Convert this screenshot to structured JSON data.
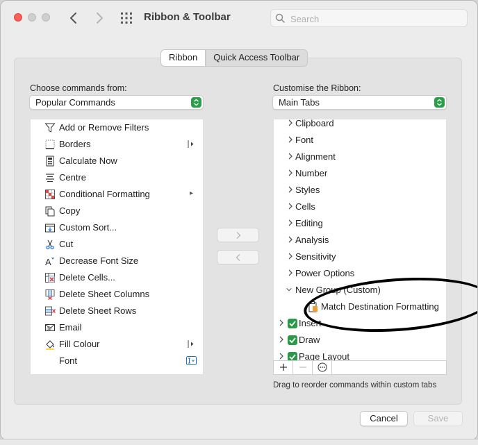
{
  "window": {
    "title": "Ribbon & Toolbar"
  },
  "search": {
    "placeholder": "Search"
  },
  "tabs": [
    {
      "label": "Ribbon",
      "active": true
    },
    {
      "label": "Quick Access Toolbar",
      "active": false
    }
  ],
  "left": {
    "label": "Choose commands from:",
    "selected": "Popular Commands",
    "commands": [
      {
        "label": "Add or Remove Filters",
        "icon": "filter-icon"
      },
      {
        "label": "Borders",
        "icon": "borders-icon",
        "submenu": "bar"
      },
      {
        "label": "Calculate Now",
        "icon": "calculator-icon"
      },
      {
        "label": "Centre",
        "icon": "align-center-icon"
      },
      {
        "label": "Conditional Formatting",
        "icon": "conditional-formatting-icon",
        "submenu": "arrow"
      },
      {
        "label": "Copy",
        "icon": "copy-icon"
      },
      {
        "label": "Custom Sort...",
        "icon": "sort-icon"
      },
      {
        "label": "Cut",
        "icon": "scissors-icon"
      },
      {
        "label": "Decrease Font Size",
        "icon": "decrease-font-icon"
      },
      {
        "label": "Delete Cells...",
        "icon": "delete-cells-icon"
      },
      {
        "label": "Delete Sheet Columns",
        "icon": "delete-columns-icon"
      },
      {
        "label": "Delete Sheet Rows",
        "icon": "delete-rows-icon"
      },
      {
        "label": "Email",
        "icon": "email-icon"
      },
      {
        "label": "Fill Colour",
        "icon": "fill-colour-icon",
        "submenu": "bar"
      },
      {
        "label": "Font",
        "icon": "",
        "submenu": "font"
      }
    ]
  },
  "right": {
    "label": "Customise the Ribbon:",
    "selected": "Main Tabs",
    "groups": [
      "Clipboard",
      "Font",
      "Alignment",
      "Number",
      "Styles",
      "Cells",
      "Editing",
      "Analysis",
      "Sensitivity",
      "Power Options"
    ],
    "custom_group": "New Group (Custom)",
    "custom_command": "Match Destination Formatting",
    "tabs": [
      "Insert",
      "Draw",
      "Page Layout"
    ]
  },
  "hint": "Drag to reorder commands within custom tabs",
  "buttons": {
    "cancel": "Cancel",
    "save": "Save"
  },
  "colors": {
    "accent_green": "#2a9a48",
    "close_red": "#ff5f57"
  }
}
